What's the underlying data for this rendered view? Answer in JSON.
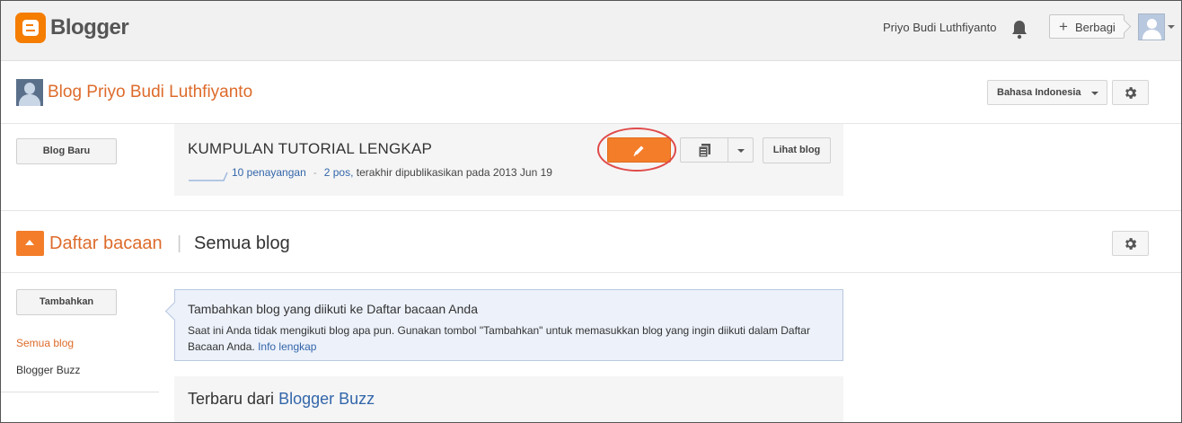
{
  "header": {
    "brand": "Blogger",
    "username": "Priyo Budi Luthfiyanto",
    "share_label": "Berbagi",
    "icons": [
      "blogger-logo",
      "bell-icon",
      "plus-icon",
      "avatar",
      "chevron-down-icon"
    ]
  },
  "blog_header": {
    "title": "Blog Priyo Budi Luthfiyanto",
    "language": "Bahasa Indonesia"
  },
  "blog_row": {
    "new_blog_label": "Blog Baru",
    "blog_name": "KUMPULAN TUTORIAL LENGKAP",
    "views": "10 penayangan",
    "separator": "-",
    "posts": "2 pos,",
    "last_published": "terakhir dipublikasikan pada 2013 Jun 19",
    "view_blog_label": "Lihat blog"
  },
  "reading_list": {
    "title": "Daftar bacaan",
    "pipe": "|",
    "subtitle": "Semua blog",
    "add_label": "Tambahkan",
    "sidebar": [
      "Semua blog",
      "Blogger Buzz"
    ],
    "info_title": "Tambahkan blog yang diikuti ke Daftar bacaan Anda",
    "info_body": "Saat ini Anda tidak mengikuti blog apa pun. Gunakan tombol \"Tambahkan\" untuk memasukkan blog yang ingin diikuti dalam Daftar Bacaan Anda.",
    "info_link": "Info lengkap",
    "latest_prefix": "Terbaru dari",
    "latest_link": "Blogger Buzz"
  },
  "colors": {
    "accent": "#f47d2a",
    "title_orange": "#dd6b2b",
    "link_blue": "#3366aa",
    "highlight_ring": "#e04a4a",
    "info_bg": "#ecf1fa"
  }
}
